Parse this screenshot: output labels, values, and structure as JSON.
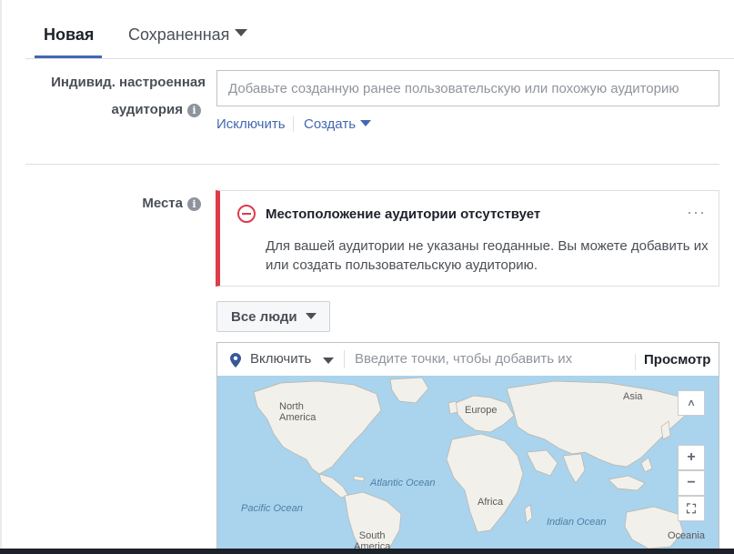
{
  "tabs": {
    "new_label": "Новая",
    "saved_label": "Сохраненная"
  },
  "custom_audience": {
    "label_line1": "Индивид. настроенная",
    "label_line2": "аудитория",
    "input_placeholder": "Добавьте созданную ранее пользовательскую или похожую аудиторию",
    "exclude_link": "Исключить",
    "create_link": "Создать"
  },
  "places": {
    "label": "Места",
    "error": {
      "title": "Местоположение аудитории отсутствует",
      "body": "Для вашей аудитории не указаны геоданные. Вы можете добавить их или создать пользовательскую аудиторию.",
      "more": "···"
    },
    "people_button": "Все люди",
    "location_mode": "Включить",
    "location_placeholder": "Введите точки, чтобы добавить их",
    "browse_button": "Просмотр"
  },
  "map": {
    "labels": {
      "north_america": "North\nAmerica",
      "europe": "Europe",
      "asia": "Asia",
      "atlantic": "Atlantic Ocean",
      "pacific": "Pacific Ocean",
      "africa": "Africa",
      "indian": "Indian Ocean",
      "south_america": "South\nAmerica",
      "oceania": "Oceania"
    },
    "controls": {
      "collapse": "˄",
      "zoom_in": "+",
      "zoom_out": "−",
      "fullscreen": "⛶"
    }
  },
  "colors": {
    "accent": "#4267b2",
    "error": "#dd3c4a",
    "water": "#aad3ed",
    "land": "#f2f0ea"
  },
  "icons": [
    "info-icon",
    "error-circle-icon",
    "more-dots-icon",
    "caret-down-icon",
    "location-pin-icon"
  ]
}
